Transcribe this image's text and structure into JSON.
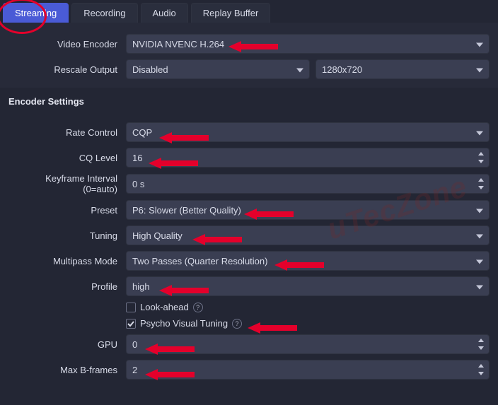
{
  "tabs": {
    "streaming": "Streaming",
    "recording": "Recording",
    "audio": "Audio",
    "replay_buffer": "Replay Buffer"
  },
  "top": {
    "video_encoder": {
      "label": "Video Encoder",
      "value": "NVIDIA NVENC H.264"
    },
    "rescale_output": {
      "label": "Rescale Output",
      "value": "Disabled",
      "resolution": "1280x720"
    }
  },
  "encoder_heading": "Encoder Settings",
  "enc": {
    "rate_control": {
      "label": "Rate Control",
      "value": "CQP"
    },
    "cq_level": {
      "label": "CQ Level",
      "value": "16"
    },
    "keyframe": {
      "label": "Keyframe Interval (0=auto)",
      "value": "0 s"
    },
    "preset": {
      "label": "Preset",
      "value": "P6: Slower (Better Quality)"
    },
    "tuning": {
      "label": "Tuning",
      "value": "High Quality"
    },
    "multipass": {
      "label": "Multipass Mode",
      "value": "Two Passes (Quarter Resolution)"
    },
    "profile": {
      "label": "Profile",
      "value": "high"
    },
    "lookahead": {
      "label": "Look-ahead",
      "checked": false
    },
    "psycho": {
      "label": "Psycho Visual Tuning",
      "checked": true
    },
    "gpu": {
      "label": "GPU",
      "value": "0"
    },
    "max_bframes": {
      "label": "Max B-frames",
      "value": "2"
    }
  },
  "watermark": "uTecZone"
}
